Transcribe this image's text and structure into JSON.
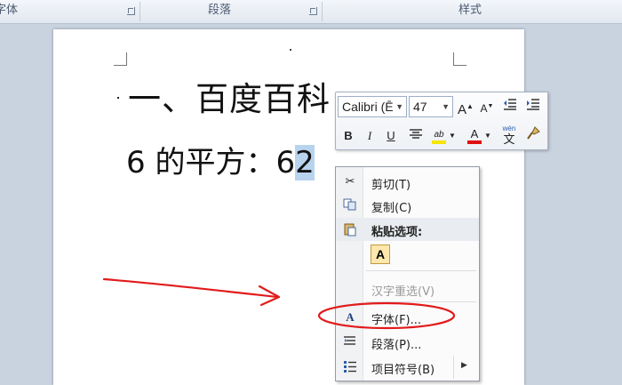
{
  "ribbon": {
    "font_group": "字体",
    "paragraph_group": "段落",
    "styles_group": "样式"
  },
  "document": {
    "heading": "一、百度百科",
    "body_prefix": "6 的平方：6",
    "body_selected": "2"
  },
  "mini_toolbar": {
    "font_name": "Calibri (Ē",
    "font_size": "47",
    "bold": "B",
    "italic": "I",
    "underline": "U",
    "font_color_letter": "A",
    "highlight_color": "#f7e600",
    "font_color": "#e01010",
    "phonetic_glyph": "wén",
    "phonetic_char": "文"
  },
  "context_menu": {
    "cut": "剪切(T)",
    "copy": "复制(C)",
    "paste_options": "粘贴选项:",
    "paste_keep_text": "A",
    "reconvert": "汉字重选(V)",
    "font": "字体(F)...",
    "paragraph": "段落(P)...",
    "bullets": "项目符号(B)"
  },
  "annotation": {
    "arrow_color": "#e21b1b",
    "circle_color": "#e21b1b"
  }
}
